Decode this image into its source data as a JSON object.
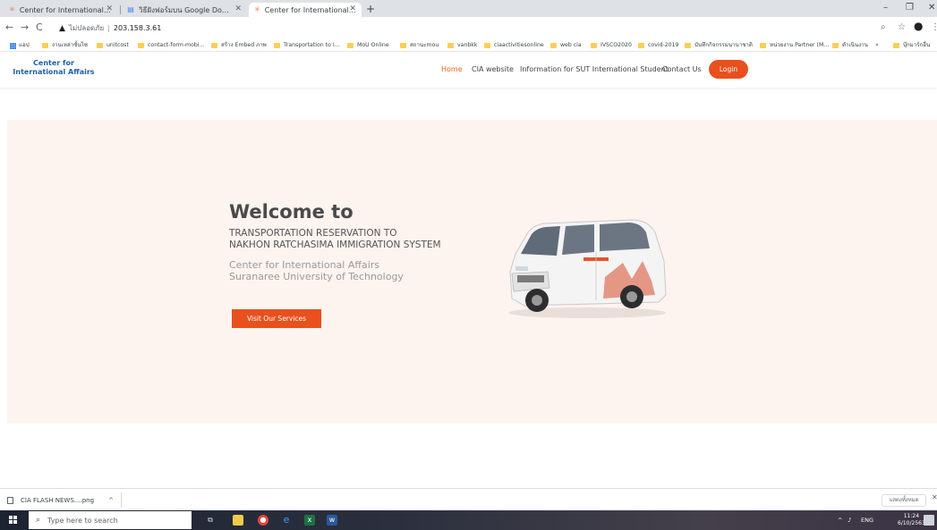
{
  "browser": {
    "tabs": [
      {
        "title": "Center for International Affairs",
        "active": false
      },
      {
        "title": "วิธีฝังฟอร์มบน Google Docs ใน",
        "active": false
      },
      {
        "title": "Center for International Affairs",
        "active": true
      }
    ],
    "new_tab": "+",
    "window_controls": {
      "minimize": "–",
      "maximize": "❐",
      "close": "✕"
    },
    "address": {
      "security_label": "ไม่ปลอดภัย",
      "url": "203.158.3.61"
    },
    "bookmarks": [
      "แอป",
      "งานเหล่าชั้นไซ",
      "unitcost",
      "contact-form-mobi...",
      "สร้าง Embed ภาพ",
      "Transportation to I...",
      "MoU Online",
      "สถานะmou",
      "vanbkk",
      "ciaactivitiesonline",
      "web cia",
      "IVSCO2020",
      "covid-2019",
      "บันทึกกิจกรรมนานาชาติ",
      "หน่วยงาน Partner (M...",
      "ดำเนินงาน",
      "»",
      "บุ๊กมาร์กอื่น"
    ]
  },
  "site": {
    "logo": {
      "line1": "Center for",
      "line2": "International Affairs"
    },
    "nav": {
      "home": "Home",
      "cia_website": "CIA website",
      "info": "Information for SUT International Student",
      "contact": "Contact Us",
      "login": "Login"
    },
    "hero": {
      "title": "Welcome to",
      "subtitle_line1": "TRANSPORTATION RESERVATION TO",
      "subtitle_line2": "NAKHON RATCHASIMA IMMIGRATION SYSTEM",
      "org_line1": "Center for International Affairs",
      "org_line2": "Suranaree University of Technology",
      "button": "Visit Our Services"
    }
  },
  "downloads": {
    "file_name": "CIA FLASH NEWS....png",
    "caret": "^",
    "show_all": "แสดงทั้งหมด",
    "close": "✕"
  },
  "taskbar": {
    "search_placeholder": "Type here to search",
    "tray_lang": "ENG",
    "time": "11:24",
    "date": "6/10/2563"
  },
  "colors": {
    "accent": "#e8501d",
    "nav_active": "#e8621f",
    "logo": "#1f5fa8",
    "hero_bg": "#fdf3ef"
  }
}
